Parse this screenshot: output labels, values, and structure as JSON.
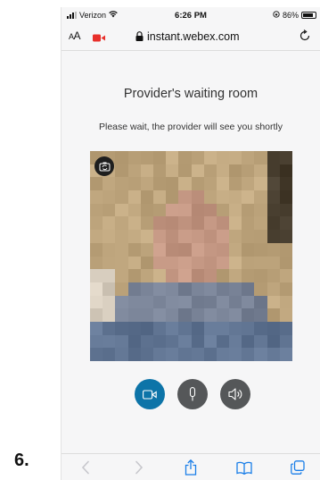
{
  "step_label": "6.",
  "status_bar": {
    "carrier": "Verizon",
    "time": "6:26 PM",
    "battery": "86%",
    "battery_level": 0.86
  },
  "url_bar": {
    "text_size_label_small": "A",
    "text_size_label_large": "A",
    "url": "instant.webex.com",
    "camera_active_color": "#e8302b"
  },
  "room": {
    "title": "Provider's waiting room",
    "subtitle": "Please wait, the provider will see you shortly"
  },
  "video": {
    "preview_state": "pixelated self-view"
  },
  "controls": {
    "video_color": "#0d74a8",
    "mic_color": "#555759",
    "speaker_color": "#555759"
  },
  "toolbar": {
    "icons": [
      "chevron-left-icon",
      "chevron-right-icon",
      "share-icon",
      "bookmarks-icon",
      "tabs-icon"
    ],
    "active_color": "#1a7ee8",
    "disabled_color": "#c7c7cc"
  }
}
